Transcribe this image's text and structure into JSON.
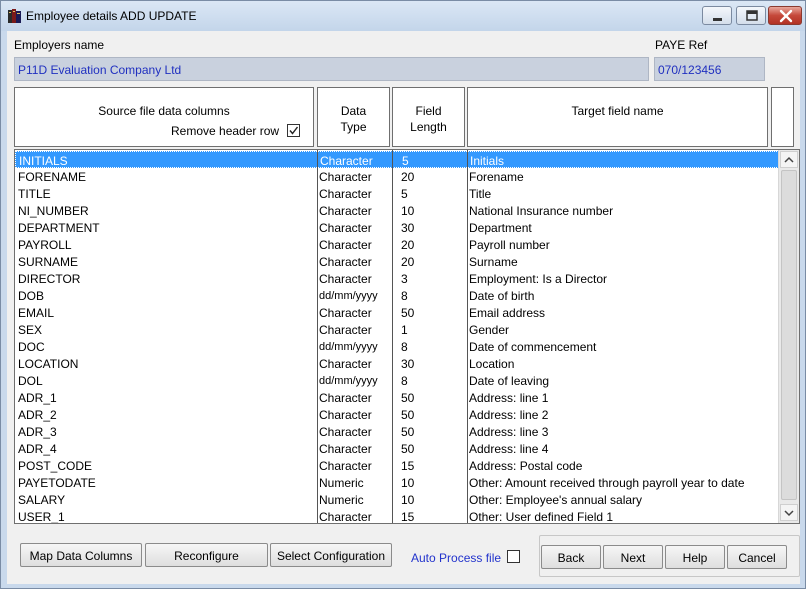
{
  "window": {
    "title": "Employee details ADD UPDATE",
    "app_icon": "books-icon",
    "controls": [
      "minimize-icon",
      "maximize-icon",
      "close-icon"
    ]
  },
  "employer": {
    "label": "Employers name",
    "value": "P11D Evaluation Company Ltd"
  },
  "paye": {
    "label": "PAYE Ref",
    "value": "070/123456"
  },
  "grid_header": {
    "source": "Source file data columns",
    "remove_header_label": "Remove header row",
    "remove_header_checked": true,
    "data_type_line1": "Data",
    "data_type_line2": "Type",
    "field_length_line1": "Field",
    "field_length_line2": "Length",
    "target": "Target field name"
  },
  "rows": [
    {
      "source": "INITIALS",
      "type": "Character",
      "length": "5",
      "target": "Initials",
      "selected": true
    },
    {
      "source": "FORENAME",
      "type": "Character",
      "length": "20",
      "target": "Forename"
    },
    {
      "source": "TITLE",
      "type": "Character",
      "length": "5",
      "target": "Title"
    },
    {
      "source": "NI_NUMBER",
      "type": "Character",
      "length": "10",
      "target": "National Insurance number"
    },
    {
      "source": "DEPARTMENT",
      "type": "Character",
      "length": "30",
      "target": "Department"
    },
    {
      "source": "PAYROLL",
      "type": "Character",
      "length": "20",
      "target": "Payroll number"
    },
    {
      "source": "SURNAME",
      "type": "Character",
      "length": "20",
      "target": "Surname"
    },
    {
      "source": "DIRECTOR",
      "type": "Character",
      "length": "3",
      "target": "Employment: Is a Director"
    },
    {
      "source": "DOB",
      "type": "dd/mm/yyyy",
      "length": "8",
      "target": "Date of birth"
    },
    {
      "source": "EMAIL",
      "type": "Character",
      "length": "50",
      "target": "Email address"
    },
    {
      "source": "SEX",
      "type": "Character",
      "length": "1",
      "target": "Gender"
    },
    {
      "source": "DOC",
      "type": "dd/mm/yyyy",
      "length": "8",
      "target": "Date of commencement"
    },
    {
      "source": "LOCATION",
      "type": "Character",
      "length": "30",
      "target": "Location"
    },
    {
      "source": "DOL",
      "type": "dd/mm/yyyy",
      "length": "8",
      "target": "Date of leaving"
    },
    {
      "source": "ADR_1",
      "type": "Character",
      "length": "50",
      "target": "Address: line 1"
    },
    {
      "source": "ADR_2",
      "type": "Character",
      "length": "50",
      "target": "Address: line 2"
    },
    {
      "source": "ADR_3",
      "type": "Character",
      "length": "50",
      "target": "Address: line 3"
    },
    {
      "source": "ADR_4",
      "type": "Character",
      "length": "50",
      "target": "Address: line 4"
    },
    {
      "source": "POST_CODE",
      "type": "Character",
      "length": "15",
      "target": "Address: Postal code"
    },
    {
      "source": "PAYETODATE",
      "type": "Numeric",
      "length": "10",
      "target": "Other: Amount received through payroll year to date"
    },
    {
      "source": "SALARY",
      "type": "Numeric",
      "length": "10",
      "target": "Other: Employee's annual salary"
    },
    {
      "source": "USER_1",
      "type": "Character",
      "length": "15",
      "target": "Other: User defined Field 1"
    }
  ],
  "buttons": {
    "map_data_columns": "Map Data Columns",
    "reconfigure": "Reconfigure",
    "select_configuration": "Select Configuration",
    "auto_process_label": "Auto Process file",
    "auto_process_checked": false,
    "back": "Back",
    "next": "Next",
    "help": "Help",
    "cancel": "Cancel"
  },
  "colors": {
    "selection": "#3399ff",
    "readonly_text": "#2030c0",
    "link_text": "#2233cc"
  }
}
